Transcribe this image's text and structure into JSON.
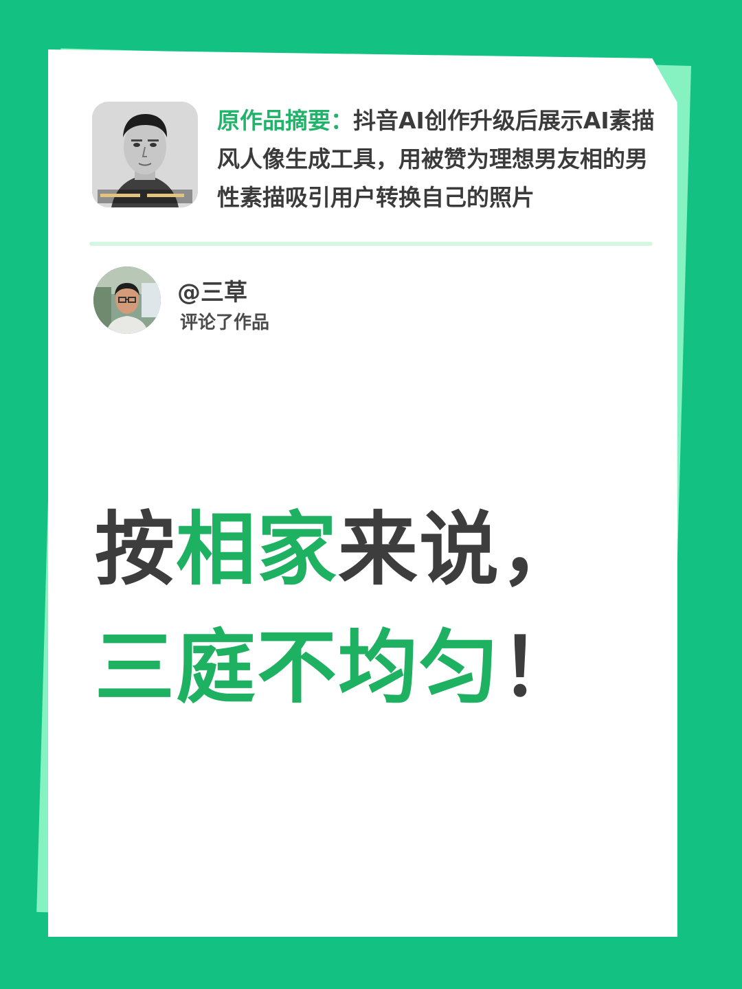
{
  "summary": {
    "label": "原作品摘要：",
    "text": "抖音AI创作升级后展示AI素描风人像生成工具，用被赞为理想男友相的男性素描吸引用户转换自己的照片"
  },
  "comment": {
    "username": "@三草",
    "action": "评论了作品"
  },
  "headline": {
    "part1": "按",
    "part2": "相家",
    "part3": "来说，",
    "part4": "三庭不均匀",
    "part5": "！"
  },
  "colors": {
    "background": "#13c183",
    "accent": "#22b36b",
    "text": "#3d3d3d"
  }
}
